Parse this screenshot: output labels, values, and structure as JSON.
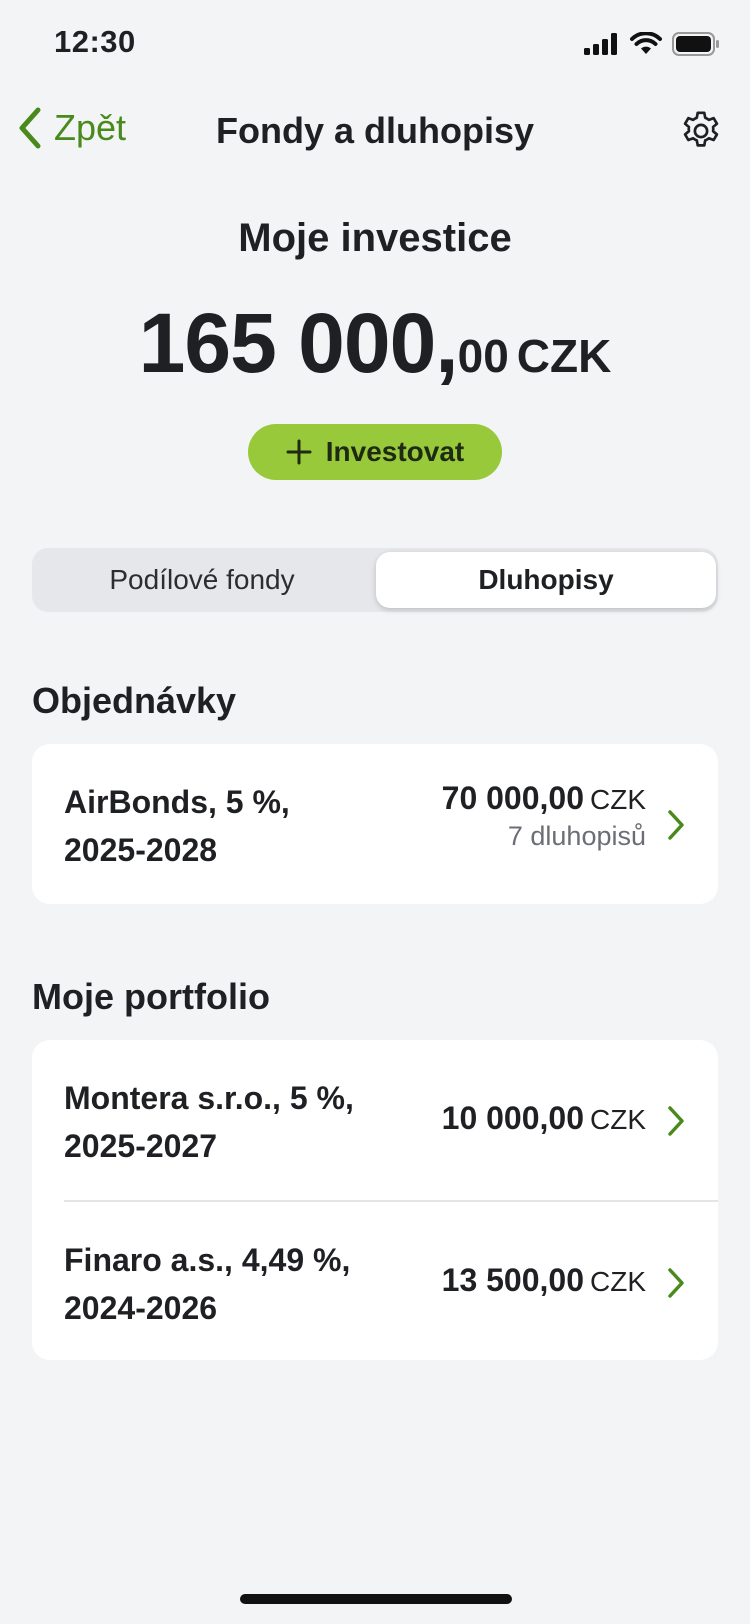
{
  "status": {
    "time": "12:30"
  },
  "nav": {
    "back_label": "Zpět",
    "title": "Fondy a dluhopisy"
  },
  "summary": {
    "title": "Moje investice",
    "amount_int": "165 000,",
    "amount_dec": "00",
    "currency": "CZK",
    "invest_label": "Investovat"
  },
  "tabs": [
    {
      "label": "Podílové fondy",
      "selected": false
    },
    {
      "label": "Dluhopisy",
      "selected": true
    }
  ],
  "orders": {
    "title": "Objednávky",
    "items": [
      {
        "name_line1": "AirBonds, 5 %,",
        "name_line2": "2025-2028",
        "amount": "70 000,00",
        "currency": "CZK",
        "sub": "7 dluhopisů"
      }
    ]
  },
  "portfolio": {
    "title": "Moje portfolio",
    "items": [
      {
        "name_line1": "Montera s.r.o., 5 %,",
        "name_line2": "2025-2027",
        "amount": "10 000,00",
        "currency": "CZK"
      },
      {
        "name_line1": "Finaro a.s., 4,49 %,",
        "name_line2": "2024-2026",
        "amount": "13 500,00",
        "currency": "CZK"
      }
    ]
  },
  "colors": {
    "accent": "#4a8a1c",
    "button": "#97c93a",
    "background": "#f3f4f6"
  },
  "icons": [
    "signal-icon",
    "wifi-icon",
    "battery-icon",
    "chevron-left-icon",
    "gear-icon",
    "plus-icon",
    "chevron-right-icon"
  ]
}
